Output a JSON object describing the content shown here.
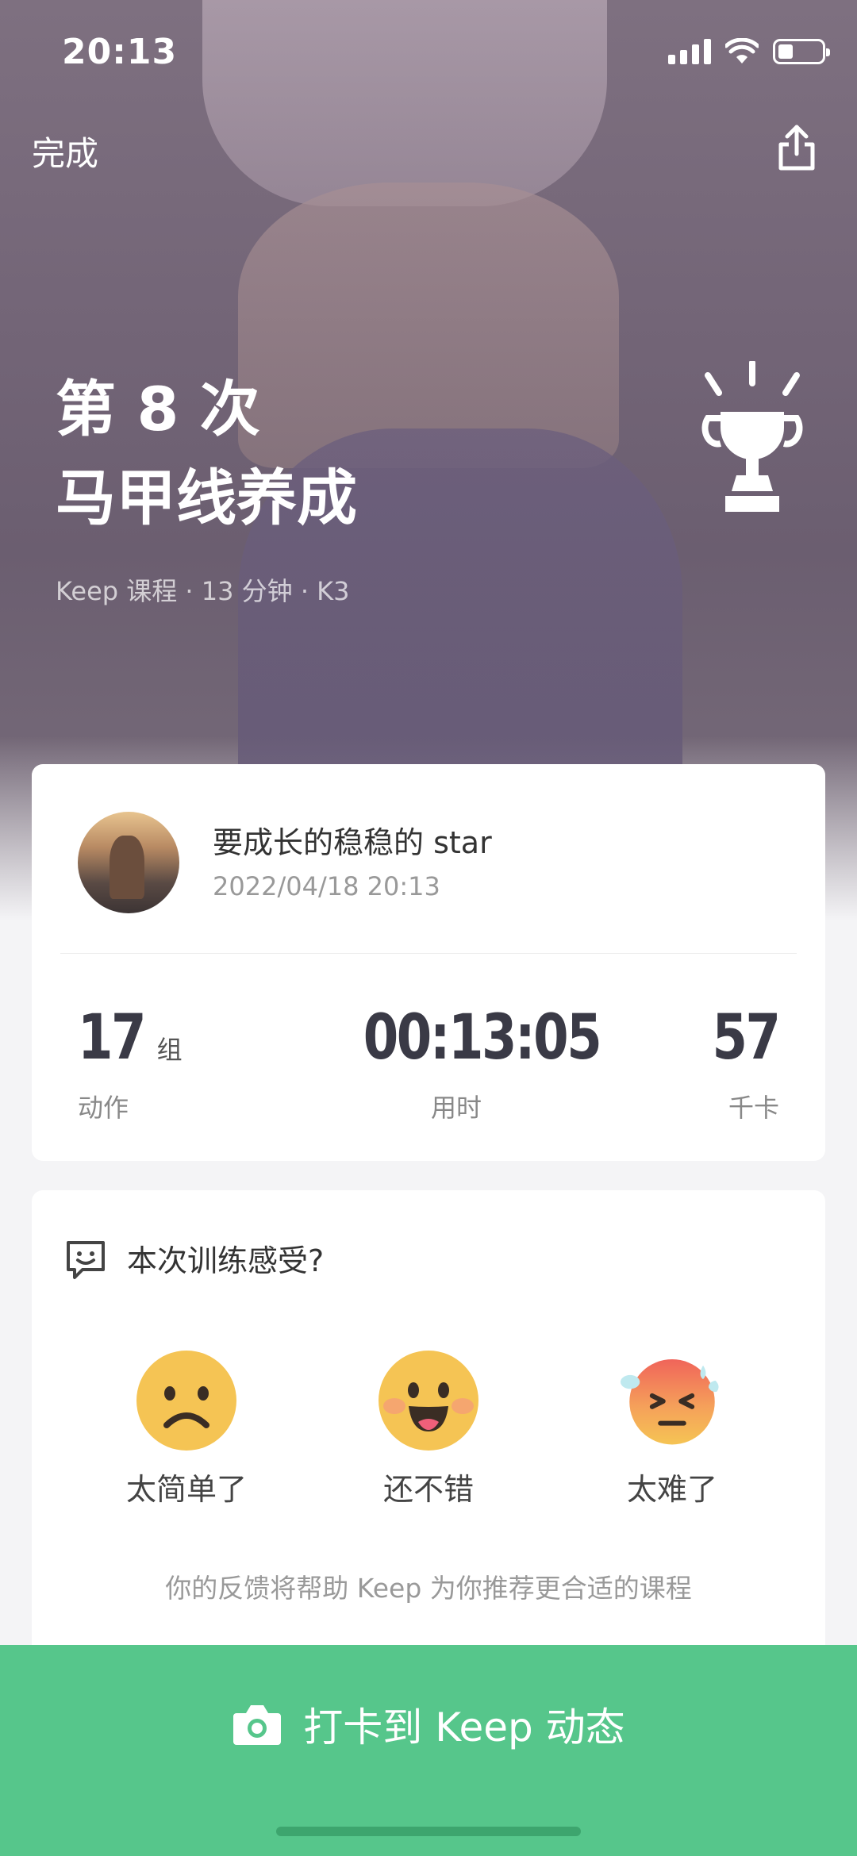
{
  "status_bar": {
    "time": "20:13"
  },
  "nav": {
    "done_label": "完成"
  },
  "workout": {
    "title_line1": "第 8 次",
    "title_line2": "马甲线养成",
    "meta": "Keep 课程 · 13 分钟 · K3"
  },
  "user": {
    "name": "要成长的稳稳的 star",
    "datetime": "2022/04/18 20:13"
  },
  "stats": {
    "sets": {
      "value": "17",
      "unit": "组",
      "label": "动作"
    },
    "duration": {
      "value": "00:13:05",
      "label": "用时"
    },
    "calories": {
      "value": "57",
      "label": "千卡"
    }
  },
  "feedback": {
    "title": "本次训练感受?",
    "options": [
      {
        "label": "太简单了",
        "icon": "frown-face-icon"
      },
      {
        "label": "还不错",
        "icon": "smile-face-icon"
      },
      {
        "label": "太难了",
        "icon": "sweating-face-icon"
      }
    ],
    "hint": "你的反馈将帮助 Keep 为你推荐更合适的课程"
  },
  "checkin": {
    "label": "打卡到 Keep 动态",
    "icon": "camera-icon"
  },
  "colors": {
    "accent": "#56c68b",
    "emoji": "#f5c454"
  }
}
